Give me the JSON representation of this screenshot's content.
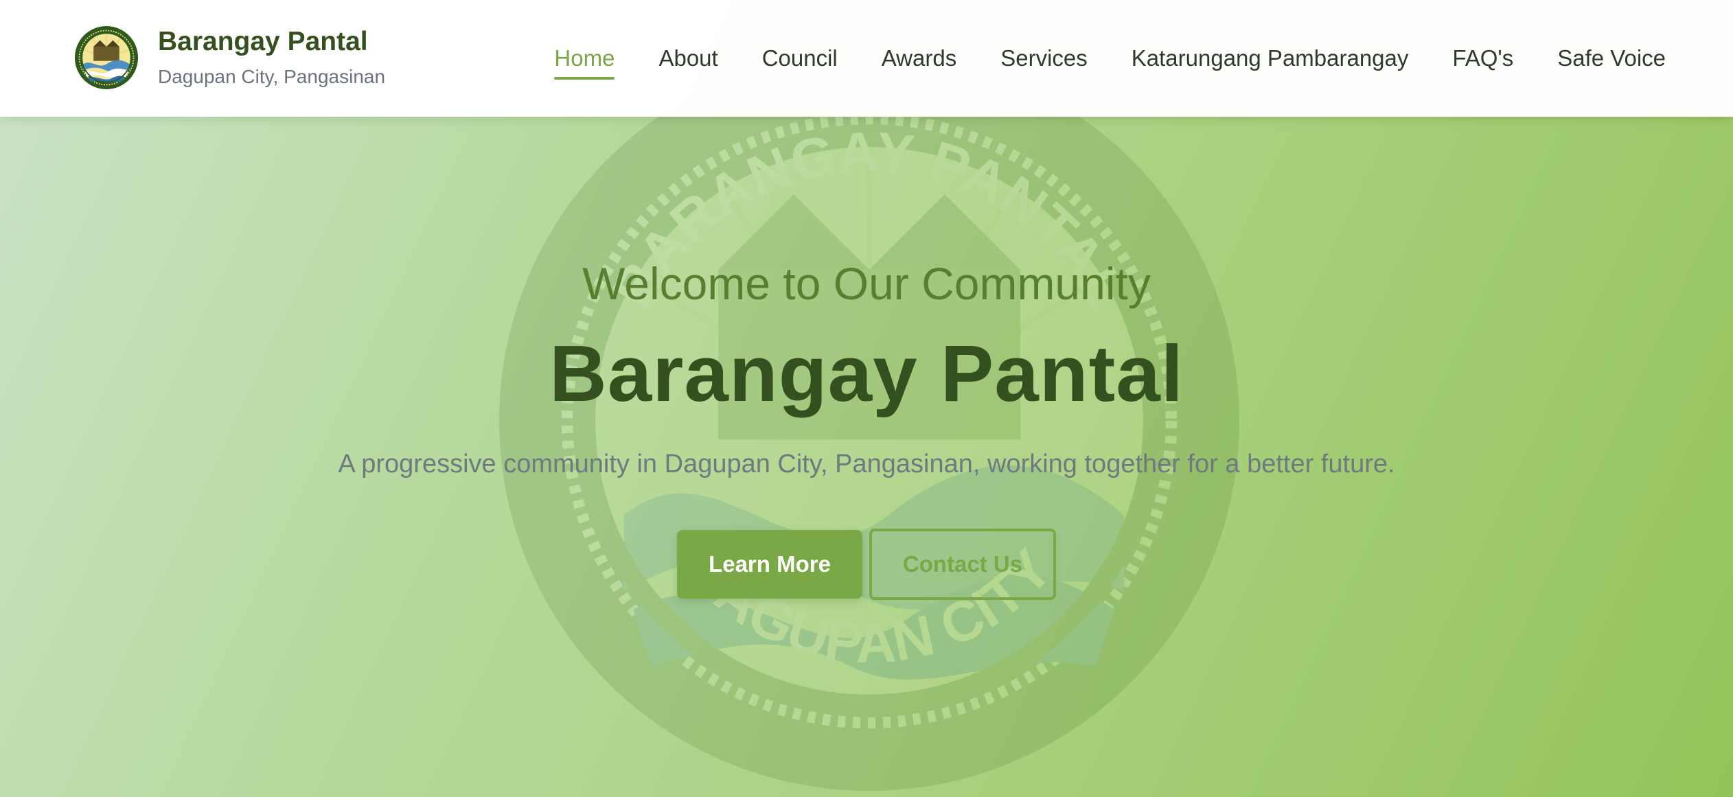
{
  "brand": {
    "title": "Barangay Pantal",
    "subtitle": "Dagupan City, Pangasinan",
    "logo_icon": "barangay-seal-icon",
    "seal_top_text": "BARANGAY PANTAL",
    "seal_bottom_text": "DAGUPAN CITY"
  },
  "nav": {
    "items": [
      {
        "label": "Home",
        "active": true
      },
      {
        "label": "About",
        "active": false
      },
      {
        "label": "Council",
        "active": false
      },
      {
        "label": "Awards",
        "active": false
      },
      {
        "label": "Services",
        "active": false
      },
      {
        "label": "Katarungang Pambarangay",
        "active": false
      },
      {
        "label": "FAQ's",
        "active": false
      },
      {
        "label": "Safe Voice",
        "active": false
      }
    ]
  },
  "hero": {
    "welcome": "Welcome to Our Community",
    "title": "Barangay Pantal",
    "description": "A progressive community in Dagupan City, Pangasinan, working together for a better future.",
    "primary_button": "Learn More",
    "secondary_button": "Contact Us"
  },
  "colors": {
    "accent": "#7aa846",
    "brand_dark": "#34501f",
    "welcome": "#587f30",
    "muted_text": "#6e7a80",
    "nav_text": "#2f3a2f"
  }
}
